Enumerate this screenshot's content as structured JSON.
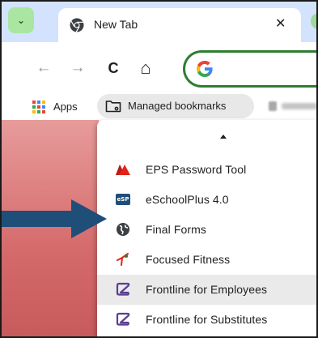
{
  "browser": {
    "tab": {
      "title": "New Tab",
      "close_glyph": "✕",
      "favicon": "chrome-favicon"
    },
    "tab_menu_glyph": "⌄",
    "toolbar": {
      "back_glyph": "←",
      "forward_glyph": "→",
      "reload_glyph": "C",
      "home_glyph": "⌂"
    },
    "bookmarks_bar": {
      "apps_label": "Apps",
      "managed_label": "Managed bookmarks"
    }
  },
  "dropdown": {
    "items": [
      {
        "label": "EPS Password Tool",
        "icon": "eps-password-icon"
      },
      {
        "label": "eSchoolPlus 4.0",
        "icon": "esp-icon",
        "badge_text": "eSP"
      },
      {
        "label": "Final Forms",
        "icon": "globe-icon"
      },
      {
        "label": "Focused Fitness",
        "icon": "focused-fitness-icon"
      },
      {
        "label": "Frontline for Employees",
        "icon": "frontline-icon",
        "highlighted": true
      },
      {
        "label": "Frontline for Substitutes",
        "icon": "frontline-icon"
      }
    ]
  },
  "colors": {
    "tabstrip": "#d3e3fd",
    "omnibox_border": "#2e7d32",
    "frontline_purple": "#5b3f8f",
    "arrow": "#1f4e79",
    "eps_red": "#e2231a"
  }
}
